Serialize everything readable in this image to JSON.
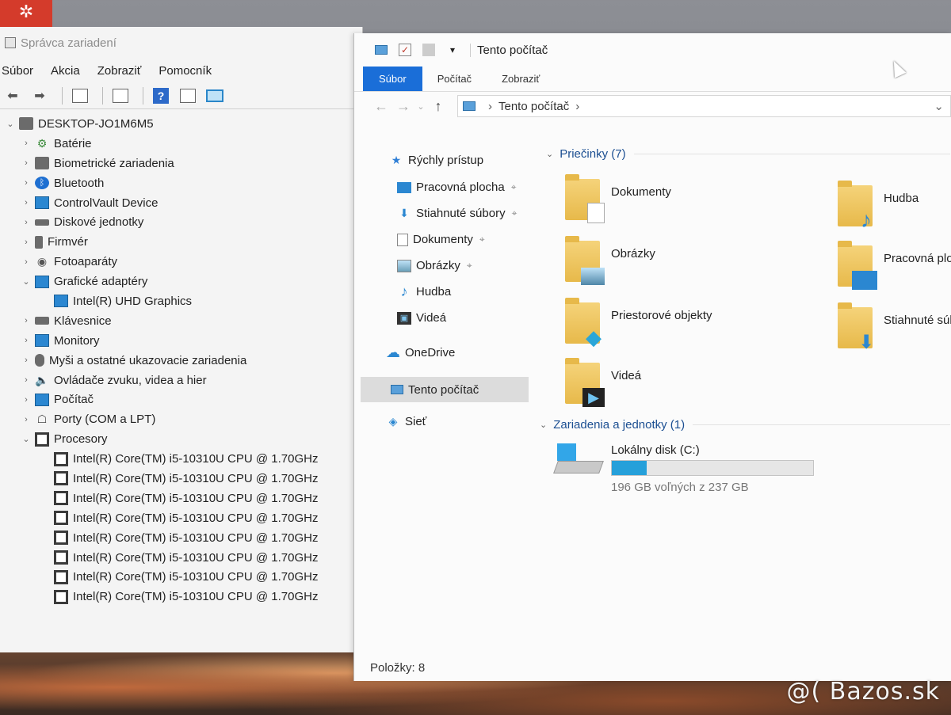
{
  "device_manager": {
    "title": "Správca zariadení",
    "menu": [
      "Súbor",
      "Akcia",
      "Zobraziť",
      "Pomocník"
    ],
    "tree": [
      {
        "label": "DESKTOP-JO1M6M5",
        "level": 0,
        "expanded": true,
        "icon": "computer-icon"
      },
      {
        "label": "Batérie",
        "level": 1,
        "icon": "battery-icon"
      },
      {
        "label": "Biometrické zariadenia",
        "level": 1,
        "icon": "fingerprint-icon"
      },
      {
        "label": "Bluetooth",
        "level": 1,
        "icon": "bluetooth-icon"
      },
      {
        "label": "ControlVault Device",
        "level": 1,
        "icon": "monitor-icon"
      },
      {
        "label": "Diskové jednotky",
        "level": 1,
        "icon": "disk-icon"
      },
      {
        "label": "Firmvér",
        "level": 1,
        "icon": "firmware-icon"
      },
      {
        "label": "Fotoaparáty",
        "level": 1,
        "icon": "camera-icon"
      },
      {
        "label": "Grafické adaptéry",
        "level": 1,
        "expanded": true,
        "icon": "display-adapter-icon"
      },
      {
        "label": "Intel(R) UHD Graphics",
        "level": 2,
        "icon": "display-adapter-icon"
      },
      {
        "label": "Klávesnice",
        "level": 1,
        "icon": "keyboard-icon"
      },
      {
        "label": "Monitory",
        "level": 1,
        "icon": "monitor-icon"
      },
      {
        "label": "Myši a ostatné ukazovacie zariadenia",
        "level": 1,
        "icon": "mouse-icon"
      },
      {
        "label": "Ovládače zvuku, videa a hier",
        "level": 1,
        "icon": "speaker-icon"
      },
      {
        "label": "Počítač",
        "level": 1,
        "icon": "monitor-icon"
      },
      {
        "label": "Porty (COM a LPT)",
        "level": 1,
        "icon": "port-icon"
      },
      {
        "label": "Procesory",
        "level": 1,
        "expanded": true,
        "icon": "cpu-icon"
      },
      {
        "label": "Intel(R) Core(TM) i5-10310U CPU @ 1.70GHz",
        "level": 2,
        "icon": "cpu-icon"
      },
      {
        "label": "Intel(R) Core(TM) i5-10310U CPU @ 1.70GHz",
        "level": 2,
        "icon": "cpu-icon"
      },
      {
        "label": "Intel(R) Core(TM) i5-10310U CPU @ 1.70GHz",
        "level": 2,
        "icon": "cpu-icon"
      },
      {
        "label": "Intel(R) Core(TM) i5-10310U CPU @ 1.70GHz",
        "level": 2,
        "icon": "cpu-icon"
      },
      {
        "label": "Intel(R) Core(TM) i5-10310U CPU @ 1.70GHz",
        "level": 2,
        "icon": "cpu-icon"
      },
      {
        "label": "Intel(R) Core(TM) i5-10310U CPU @ 1.70GHz",
        "level": 2,
        "icon": "cpu-icon"
      },
      {
        "label": "Intel(R) Core(TM) i5-10310U CPU @ 1.70GHz",
        "level": 2,
        "icon": "cpu-icon"
      },
      {
        "label": "Intel(R) Core(TM) i5-10310U CPU @ 1.70GHz",
        "level": 2,
        "icon": "cpu-icon"
      }
    ]
  },
  "explorer": {
    "title": "Tento počítač",
    "tabs": [
      "Súbor",
      "Počítač",
      "Zobraziť"
    ],
    "address": {
      "crumb": "Tento počítač"
    },
    "nav": {
      "quick_access": "Rýchly prístup",
      "pinned": [
        "Pracovná plocha",
        "Stiahnuté súbory",
        "Dokumenty",
        "Obrázky"
      ],
      "unpinned": [
        "Hudba",
        "Videá"
      ],
      "onedrive": "OneDrive",
      "this_pc": "Tento počítač",
      "network": "Sieť"
    },
    "folders_header": "Priečinky (7)",
    "folders": [
      {
        "name": "Dokumenty",
        "icon": "documents-folder-icon"
      },
      {
        "name": "Obrázky",
        "icon": "pictures-folder-icon"
      },
      {
        "name": "Priestorové objekty",
        "icon": "3d-objects-folder-icon"
      },
      {
        "name": "Videá",
        "icon": "videos-folder-icon"
      },
      {
        "name": "Hudba",
        "icon": "music-folder-icon"
      },
      {
        "name": "Pracovná plo",
        "icon": "desktop-folder-icon"
      },
      {
        "name": "Stiahnuté súb",
        "icon": "downloads-folder-icon"
      }
    ],
    "drives_header": "Zariadenia a jednotky (1)",
    "drive": {
      "name": "Lokálny disk (C:)",
      "free": "196 GB voľných z 237 GB",
      "used_fraction": 0.173
    },
    "status": "Položky: 8"
  },
  "watermark": "@( Bazos.sk"
}
